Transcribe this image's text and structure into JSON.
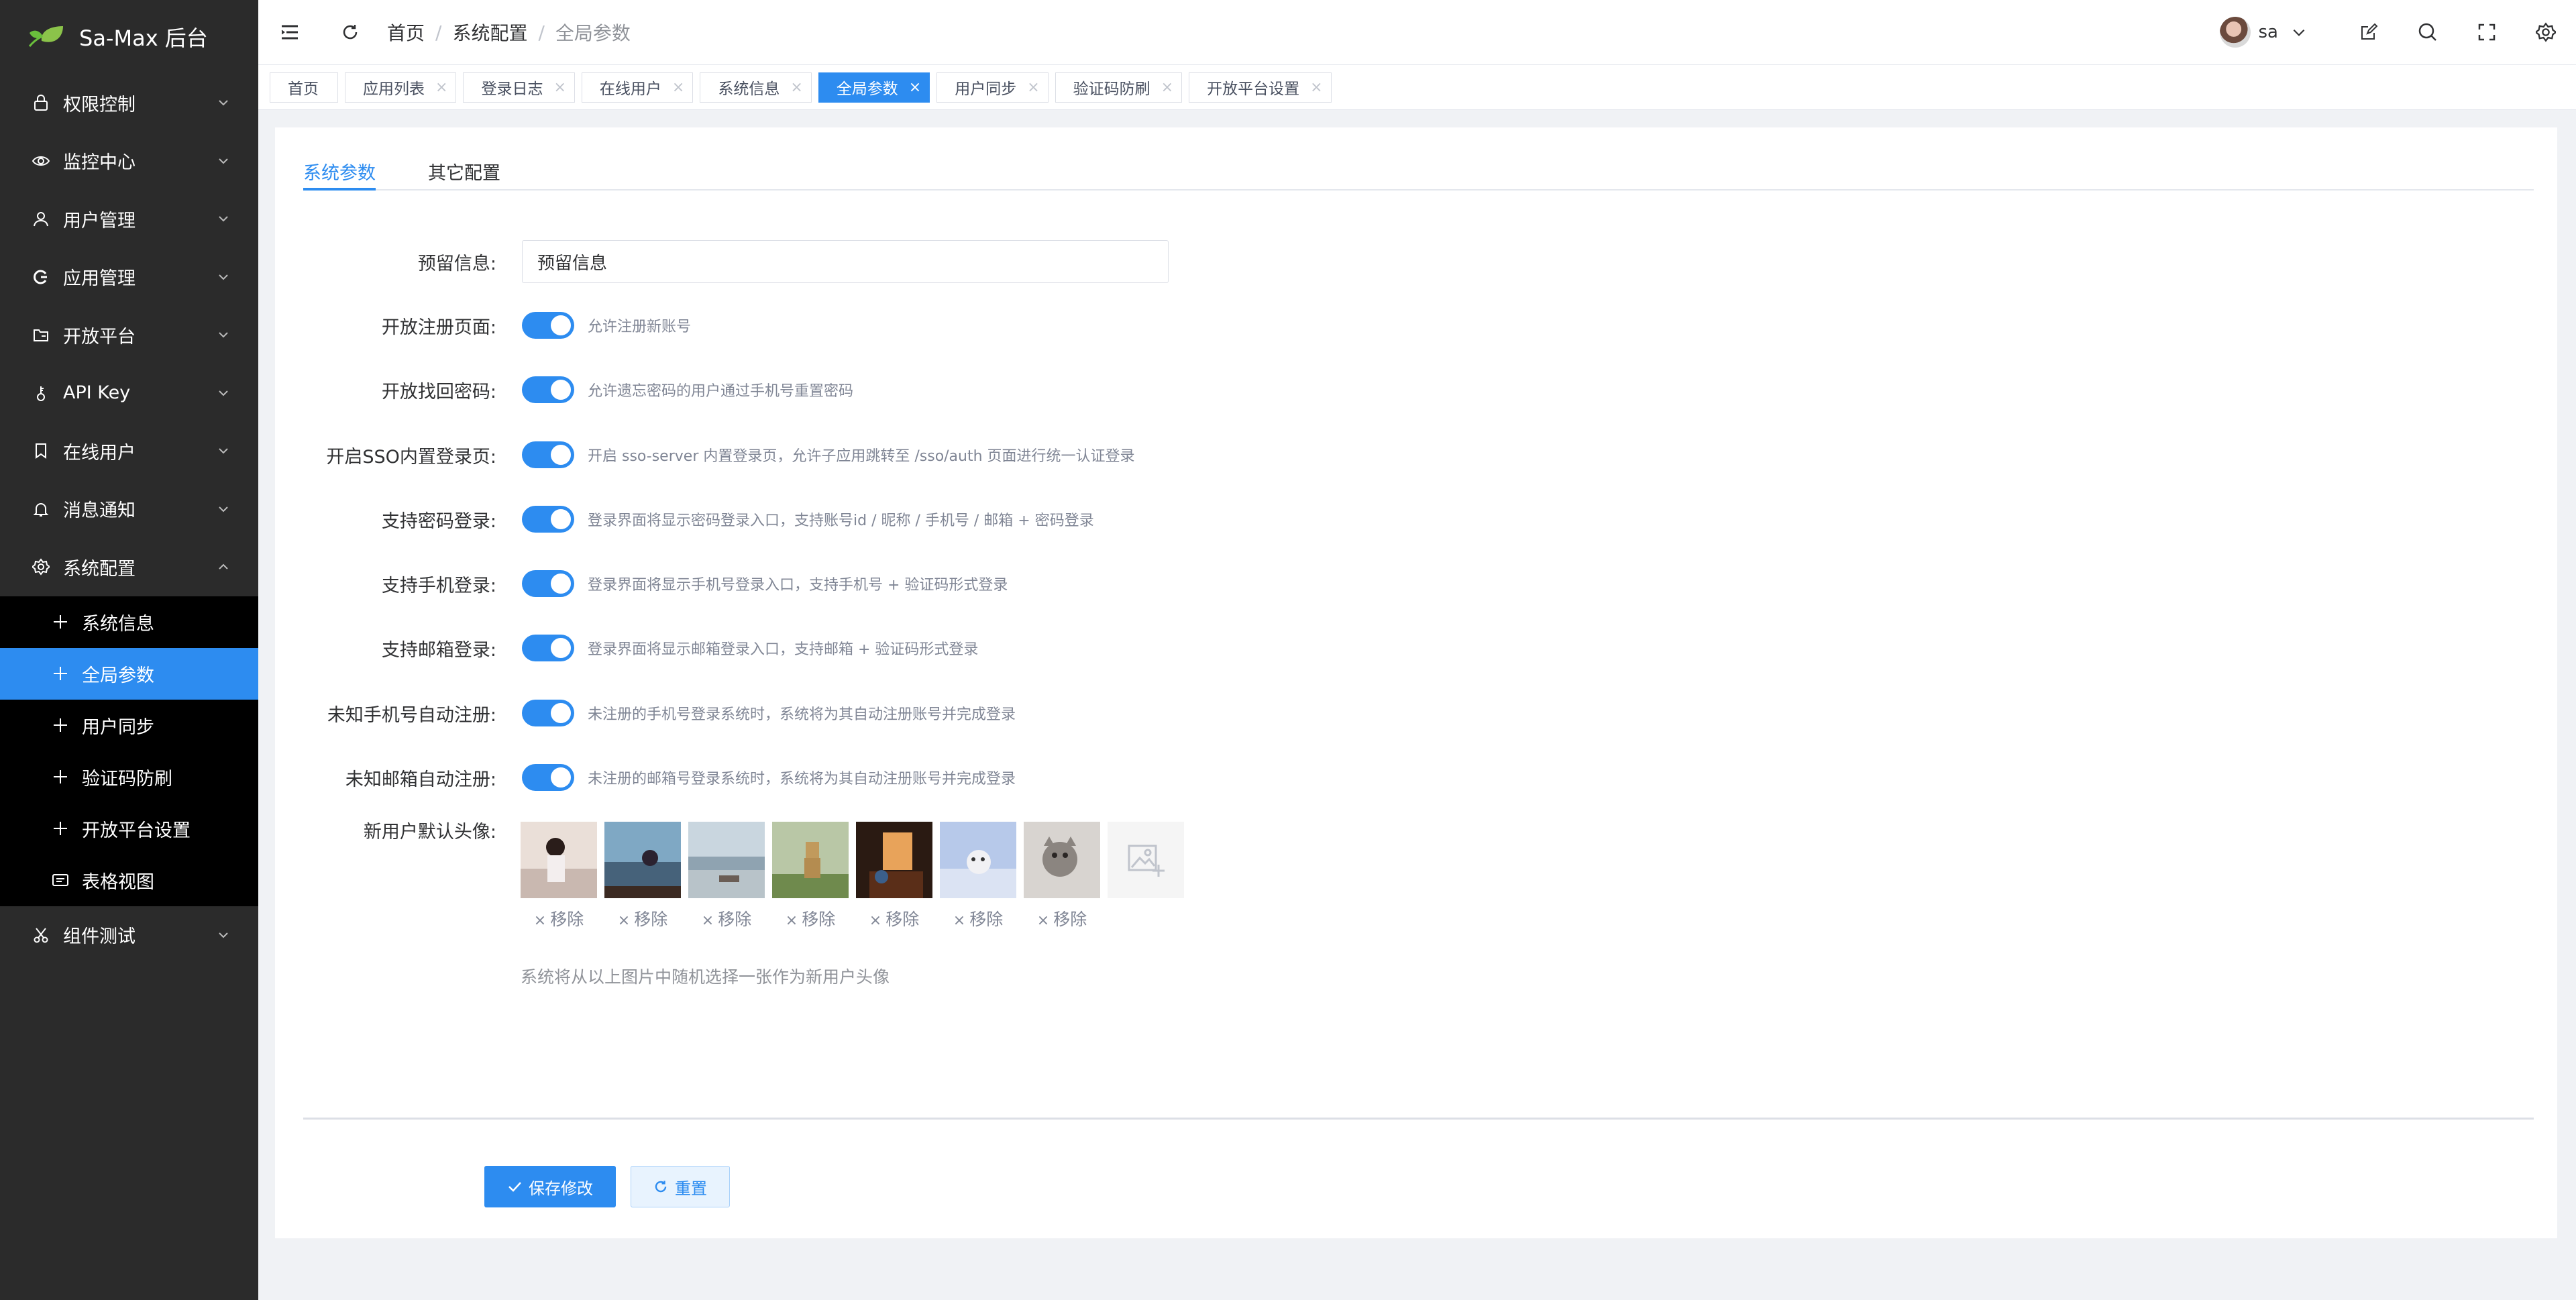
{
  "app": {
    "brand": "Sa-Max 后台"
  },
  "sidebar": {
    "items": [
      {
        "label": "权限控制",
        "icon": "lock-icon"
      },
      {
        "label": "监控中心",
        "icon": "eye-icon"
      },
      {
        "label": "用户管理",
        "icon": "user-icon"
      },
      {
        "label": "应用管理",
        "icon": "app-icon"
      },
      {
        "label": "开放平台",
        "icon": "folder-icon"
      },
      {
        "label": "API Key",
        "icon": "key-icon"
      },
      {
        "label": "在线用户",
        "icon": "bookmark-icon"
      },
      {
        "label": "消息通知",
        "icon": "bell-icon"
      },
      {
        "label": "系统配置",
        "icon": "gear-icon"
      }
    ],
    "submenu": [
      {
        "label": "系统信息",
        "icon": "plus-icon"
      },
      {
        "label": "全局参数",
        "icon": "plus-icon"
      },
      {
        "label": "用户同步",
        "icon": "plus-icon"
      },
      {
        "label": "验证码防刷",
        "icon": "plus-icon"
      },
      {
        "label": "开放平台设置",
        "icon": "plus-icon"
      },
      {
        "label": "表格视图",
        "icon": "table-icon"
      }
    ],
    "after": {
      "label": "组件测试",
      "icon": "scissors-icon"
    }
  },
  "header": {
    "breadcrumb": [
      "首页",
      "系统配置",
      "全局参数"
    ],
    "user": "sa"
  },
  "tabs": [
    "首页",
    "应用列表",
    "登录日志",
    "在线用户",
    "系统信息",
    "全局参数",
    "用户同步",
    "验证码防刷",
    "开放平台设置"
  ],
  "inner_tabs": [
    "系统参数",
    "其它配置"
  ],
  "form": {
    "reserve_label": "预留信息:",
    "reserve_value": "预留信息",
    "switches": [
      {
        "label": "开放注册页面:",
        "desc": "允许注册新账号"
      },
      {
        "label": "开放找回密码:",
        "desc": "允许遗忘密码的用户通过手机号重置密码"
      },
      {
        "label": "开启SSO内置登录页:",
        "desc": "开启 sso-server 内置登录页，允许子应用跳转至 /sso/auth 页面进行统一认证登录"
      },
      {
        "label": "支持密码登录:",
        "desc": "登录界面将显示密码登录入口，支持账号id / 昵称 / 手机号 / 邮箱 + 密码登录"
      },
      {
        "label": "支持手机登录:",
        "desc": "登录界面将显示手机号登录入口，支持手机号 + 验证码形式登录"
      },
      {
        "label": "支持邮箱登录:",
        "desc": "登录界面将显示邮箱登录入口，支持邮箱 + 验证码形式登录"
      },
      {
        "label": "未知手机号自动注册:",
        "desc": "未注册的手机号登录系统时，系统将为其自动注册账号并完成登录"
      },
      {
        "label": "未知邮箱自动注册:",
        "desc": "未注册的邮箱号登录系统时，系统将为其自动注册账号并完成登录"
      }
    ],
    "avatar_label": "新用户默认头像:",
    "avatar_remove": "移除",
    "avatar_hint": "系统将从以上图片中随机选择一张作为新用户头像",
    "save_label": "保存修改",
    "reset_label": "重置"
  },
  "colors": {
    "accent": "#2d8cf0",
    "sidebar": "#2b2b2b"
  }
}
